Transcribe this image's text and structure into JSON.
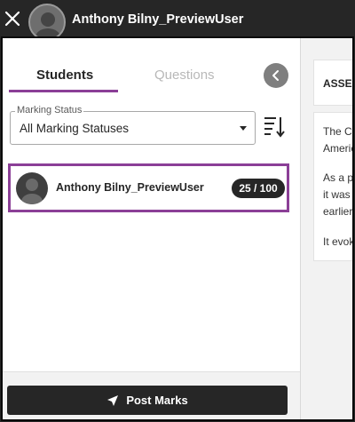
{
  "topbar": {
    "user_name": "Anthony Bilny_PreviewUser",
    "close_icon": "close-icon",
    "avatar_icon": "avatar-icon"
  },
  "tabs": [
    {
      "label": "Students",
      "active": true
    },
    {
      "label": "Questions",
      "active": false
    }
  ],
  "filter": {
    "legend": "Marking Status",
    "value": "All Marking Statuses"
  },
  "students": [
    {
      "name": "Anthony Bilny_PreviewUser",
      "score": "25 / 100"
    }
  ],
  "footer": {
    "post_label": "Post Marks"
  },
  "content": {
    "assess_title": "ASSESS",
    "lines": [
      "The Co",
      "Americ",
      "As a p",
      "it was",
      "earlier",
      "It evok"
    ]
  },
  "colors": {
    "accent": "#8b3f97",
    "dark": "#262626",
    "muted_tab": "#b8b8b8"
  }
}
